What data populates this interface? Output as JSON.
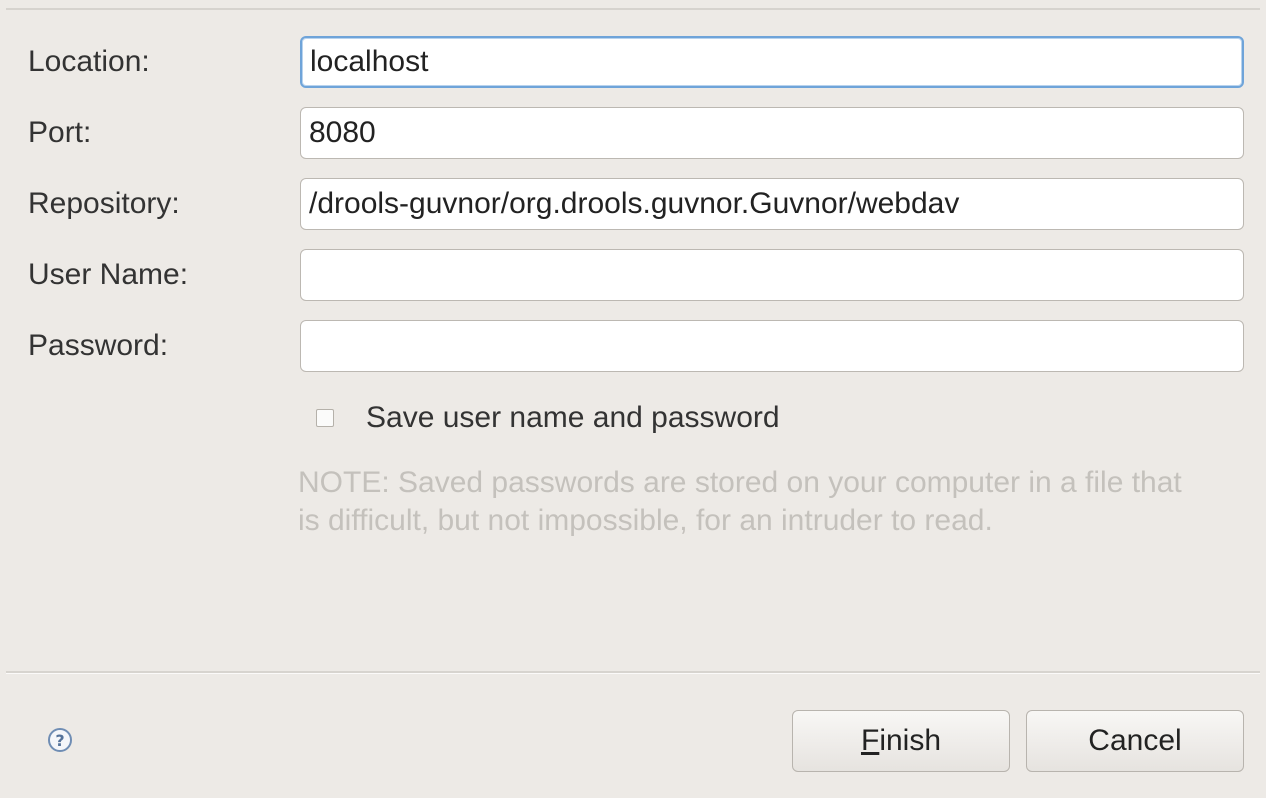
{
  "form": {
    "location": {
      "label": "Location:",
      "value": "localhost"
    },
    "port": {
      "label": "Port:",
      "value": "8080"
    },
    "repository": {
      "label": "Repository:",
      "value": "/drools-guvnor/org.drools.guvnor.Guvnor/webdav"
    },
    "username": {
      "label": "User Name:",
      "value": ""
    },
    "password": {
      "label": "Password:",
      "value": ""
    },
    "save_credentials": {
      "label": "Save user name and password",
      "checked": false
    },
    "note": "NOTE: Saved passwords are stored on your computer in a file that is difficult, but not impossible, for an intruder to read."
  },
  "footer": {
    "help_icon": "help-icon",
    "finish": {
      "mnemonic": "F",
      "rest": "inish"
    },
    "cancel_label": "Cancel"
  },
  "colors": {
    "background": "#edeae6",
    "focus_border": "#6fa4d9",
    "note_text": "#c4c1bc"
  }
}
